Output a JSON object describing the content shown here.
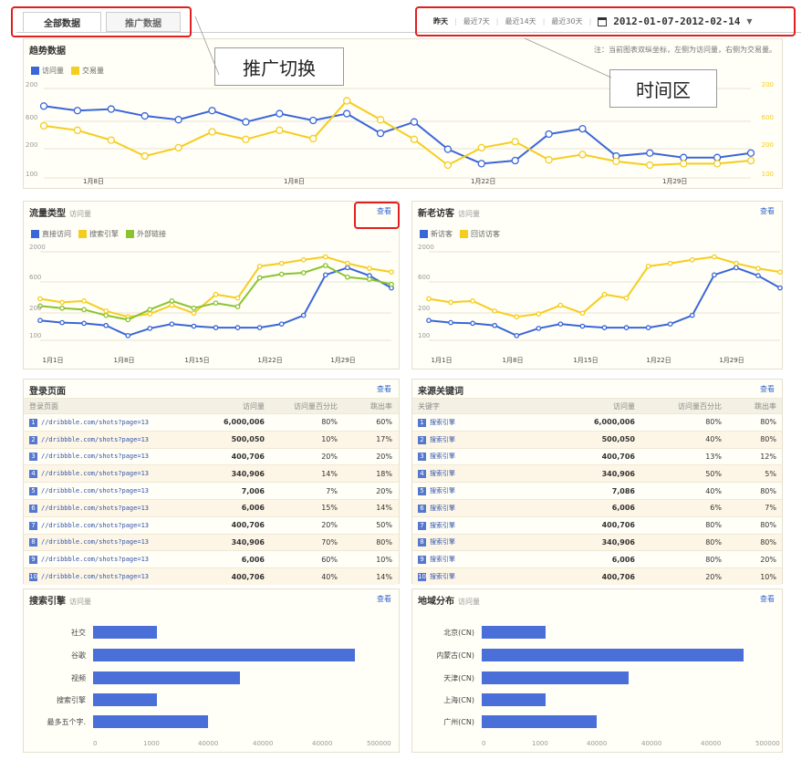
{
  "tabs": [
    "全部数据",
    "推广数据"
  ],
  "time_ranges": [
    "昨天",
    "最近7天",
    "最近14天",
    "最近30天"
  ],
  "date_range": "2012-01-07-2012-02-14",
  "annotations": {
    "tab_switch": "推广切换",
    "time_area": "时间区"
  },
  "trend": {
    "title": "趋势数据",
    "note": "注：当前图表双纵坐标，左侧为访问量，右侧为交易量。",
    "legend": [
      "访问量",
      "交易量"
    ],
    "y_left": [
      "200",
      "600",
      "200",
      "100"
    ],
    "y_right": [
      "200",
      "600",
      "200",
      "100"
    ],
    "x_labels": [
      "1月8日",
      "1月8日",
      "1月22日",
      "1月29日"
    ]
  },
  "traffic": {
    "title": "流量类型",
    "subtitle": "访问量",
    "link": "查看",
    "legend": [
      "直接访问",
      "搜索引擎",
      "外部链接"
    ],
    "y": [
      "2000",
      "600",
      "200",
      "100"
    ],
    "x": [
      "1月1日",
      "1月8日",
      "1月15日",
      "1月22日",
      "1月29日"
    ]
  },
  "visitors": {
    "title": "新老访客",
    "subtitle": "访问量",
    "link": "查看",
    "legend": [
      "新访客",
      "回访访客"
    ],
    "y": [
      "2000",
      "600",
      "200",
      "100"
    ],
    "x": [
      "1月1日",
      "1月8日",
      "1月15日",
      "1月22日",
      "1月29日"
    ]
  },
  "login_pages": {
    "title": "登录页面",
    "link": "查看",
    "headers": [
      "登录页面",
      "访问量",
      "访问量百分比",
      "跳出率"
    ],
    "rows": [
      [
        "//dribbble.com/shots?page=13",
        "6,000,006",
        "80%",
        "60%"
      ],
      [
        "//dribbble.com/shots?page=13",
        "500,050",
        "10%",
        "17%"
      ],
      [
        "//dribbble.com/shots?page=13",
        "400,706",
        "20%",
        "20%"
      ],
      [
        "//dribbble.com/shots?page=13",
        "340,906",
        "14%",
        "18%"
      ],
      [
        "//dribbble.com/shots?page=13",
        "7,006",
        "7%",
        "20%"
      ],
      [
        "//dribbble.com/shots?page=13",
        "6,006",
        "15%",
        "14%"
      ],
      [
        "//dribbble.com/shots?page=13",
        "400,706",
        "20%",
        "50%"
      ],
      [
        "//dribbble.com/shots?page=13",
        "340,906",
        "70%",
        "80%"
      ],
      [
        "//dribbble.com/shots?page=13",
        "6,006",
        "60%",
        "10%"
      ],
      [
        "//dribbble.com/shots?page=13",
        "400,706",
        "40%",
        "14%"
      ]
    ]
  },
  "keywords": {
    "title": "来源关键词",
    "link": "查看",
    "headers": [
      "关键字",
      "访问量",
      "访问量百分比",
      "跳出率"
    ],
    "rows": [
      [
        "搜索引擎",
        "6,000,006",
        "80%",
        "80%"
      ],
      [
        "搜索引擎",
        "500,050",
        "40%",
        "80%"
      ],
      [
        "搜索引擎",
        "400,706",
        "13%",
        "12%"
      ],
      [
        "搜索引擎",
        "340,906",
        "50%",
        "5%"
      ],
      [
        "搜索引擎",
        "7,086",
        "40%",
        "80%"
      ],
      [
        "搜索引擎",
        "6,006",
        "6%",
        "7%"
      ],
      [
        "搜索引擎",
        "400,706",
        "80%",
        "80%"
      ],
      [
        "搜索引擎",
        "340,906",
        "80%",
        "80%"
      ],
      [
        "搜索引擎",
        "6,006",
        "80%",
        "20%"
      ],
      [
        "搜索引擎",
        "400,706",
        "20%",
        "10%"
      ]
    ]
  },
  "search": {
    "title": "搜索引擎",
    "subtitle": "访问量",
    "link": "查看",
    "ticks": [
      "0",
      "1000",
      "40000",
      "40000",
      "40000",
      "500000"
    ]
  },
  "region": {
    "title": "地域分布",
    "subtitle": "访问量",
    "link": "查看",
    "ticks": [
      "0",
      "1000",
      "40000",
      "40000",
      "40000",
      "500000"
    ]
  },
  "colors": {
    "blue": "#3a66d8",
    "yellow": "#f5cd1e",
    "green": "#8ac32f"
  },
  "chart_data": [
    {
      "type": "line",
      "name": "trend",
      "y_axis_ticks": [
        "200",
        "600",
        "200",
        "100"
      ],
      "x_tick_labels": [
        "1月8日",
        "1月8日",
        "1月22日",
        "1月29日"
      ],
      "series": [
        {
          "name": "访问量",
          "values": [
            78,
            72,
            74,
            65,
            60,
            72,
            57,
            68,
            59,
            68,
            42,
            57,
            21,
            2,
            6,
            41,
            48,
            12,
            16,
            10,
            10,
            16
          ]
        },
        {
          "name": "交易量",
          "values": [
            52,
            46,
            33,
            12,
            23,
            44,
            34,
            46,
            35,
            85,
            60,
            34,
            0,
            23,
            31,
            7,
            14,
            5,
            0,
            2,
            2,
            6
          ]
        }
      ]
    },
    {
      "type": "line",
      "name": "traffic",
      "y_axis_ticks": [
        "2000",
        "600",
        "200",
        "100"
      ],
      "x_tick_labels": [
        "1月1日",
        "1月8日",
        "1月15日",
        "1月22日",
        "1月29日"
      ],
      "series": [
        {
          "name": "直接访问",
          "values": [
            25,
            22,
            21,
            18,
            4,
            14,
            20,
            17,
            15,
            15,
            15,
            20,
            32,
            88,
            98,
            87,
            70
          ]
        },
        {
          "name": "搜索引擎",
          "values": [
            55,
            50,
            52,
            38,
            30,
            34,
            46,
            35,
            61,
            56,
            100,
            104,
            109,
            113,
            104,
            97,
            92
          ]
        },
        {
          "name": "外部链接",
          "values": [
            45,
            42,
            40,
            32,
            26,
            40,
            52,
            42,
            49,
            44,
            84,
            89,
            91,
            101,
            85,
            82,
            75
          ]
        }
      ]
    },
    {
      "type": "line",
      "name": "visitors",
      "y_axis_ticks": [
        "2000",
        "600",
        "200",
        "100"
      ],
      "x_tick_labels": [
        "1月1日",
        "1月8日",
        "1月15日",
        "1月22日",
        "1月29日"
      ],
      "series": [
        {
          "name": "新访客",
          "values": [
            25,
            22,
            21,
            18,
            4,
            14,
            20,
            17,
            15,
            15,
            15,
            20,
            32,
            88,
            98,
            87,
            70
          ]
        },
        {
          "name": "回访访客",
          "values": [
            55,
            50,
            52,
            38,
            30,
            34,
            46,
            35,
            61,
            56,
            100,
            104,
            109,
            113,
            104,
            97,
            92
          ]
        }
      ]
    },
    {
      "type": "bar",
      "name": "search",
      "categories": [
        "社交",
        "谷歌",
        "视频",
        "搜索引擎",
        "最多五个字."
      ],
      "values": [
        80,
        330,
        185,
        80,
        145
      ]
    },
    {
      "type": "bar",
      "name": "region",
      "categories": [
        "北京(CN)",
        "内蒙古(CN)",
        "天津(CN)",
        "上海(CN)",
        "广州(CN)"
      ],
      "values": [
        80,
        330,
        185,
        80,
        145
      ]
    }
  ]
}
